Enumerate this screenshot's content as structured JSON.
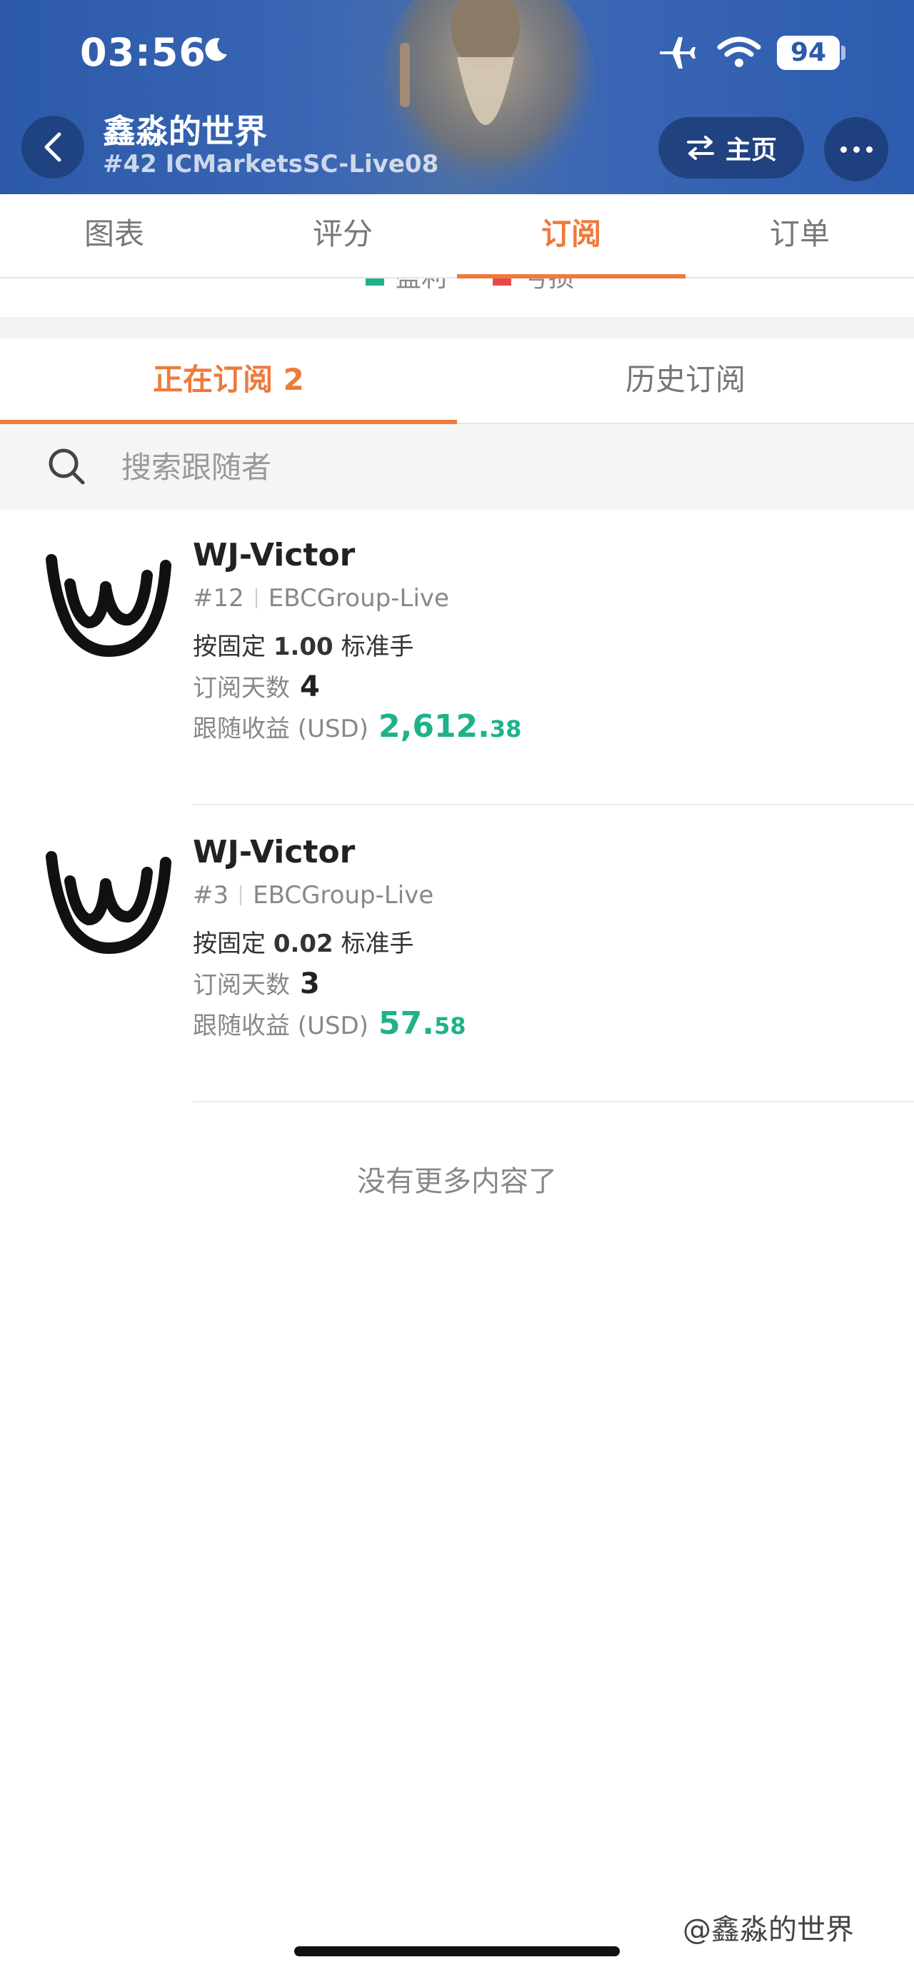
{
  "status_bar": {
    "time": "03:56",
    "battery": "94"
  },
  "header": {
    "title": "鑫淼的世界",
    "subtitle": "#42 ICMarketsSC-Live08",
    "home_label": "主页"
  },
  "main_tabs": [
    {
      "label": "图表"
    },
    {
      "label": "评分"
    },
    {
      "label": "订阅"
    },
    {
      "label": "订单"
    }
  ],
  "legend_fragment": [
    {
      "label": "盈利",
      "color": "#1fb28a"
    },
    {
      "label": "亏损",
      "color": "#e5484d"
    }
  ],
  "sub_tabs": [
    {
      "label": "正在订阅 2"
    },
    {
      "label": "历史订阅"
    }
  ],
  "search": {
    "placeholder": "搜索跟随者",
    "value": ""
  },
  "subscriptions": [
    {
      "name": "WJ-Victor",
      "rank": "#12",
      "server": "EBCGroup-Live",
      "lot_prefix": "按固定",
      "lot_value": "1.00",
      "lot_suffix": "标准手",
      "days_label": "订阅天数",
      "days": "4",
      "profit_label": "跟随收益 (USD)",
      "profit_int": "2,612.",
      "profit_dec": "38"
    },
    {
      "name": "WJ-Victor",
      "rank": "#3",
      "server": "EBCGroup-Live",
      "lot_prefix": "按固定",
      "lot_value": "0.02",
      "lot_suffix": "标准手",
      "days_label": "订阅天数",
      "days": "3",
      "profit_label": "跟随收益 (USD)",
      "profit_int": "57.",
      "profit_dec": "58"
    }
  ],
  "end_text": "没有更多内容了",
  "watermark": "@鑫淼的世界",
  "colors": {
    "accent": "#ee7a3c",
    "profit": "#1fb28a",
    "header": "#2b5aa8"
  }
}
